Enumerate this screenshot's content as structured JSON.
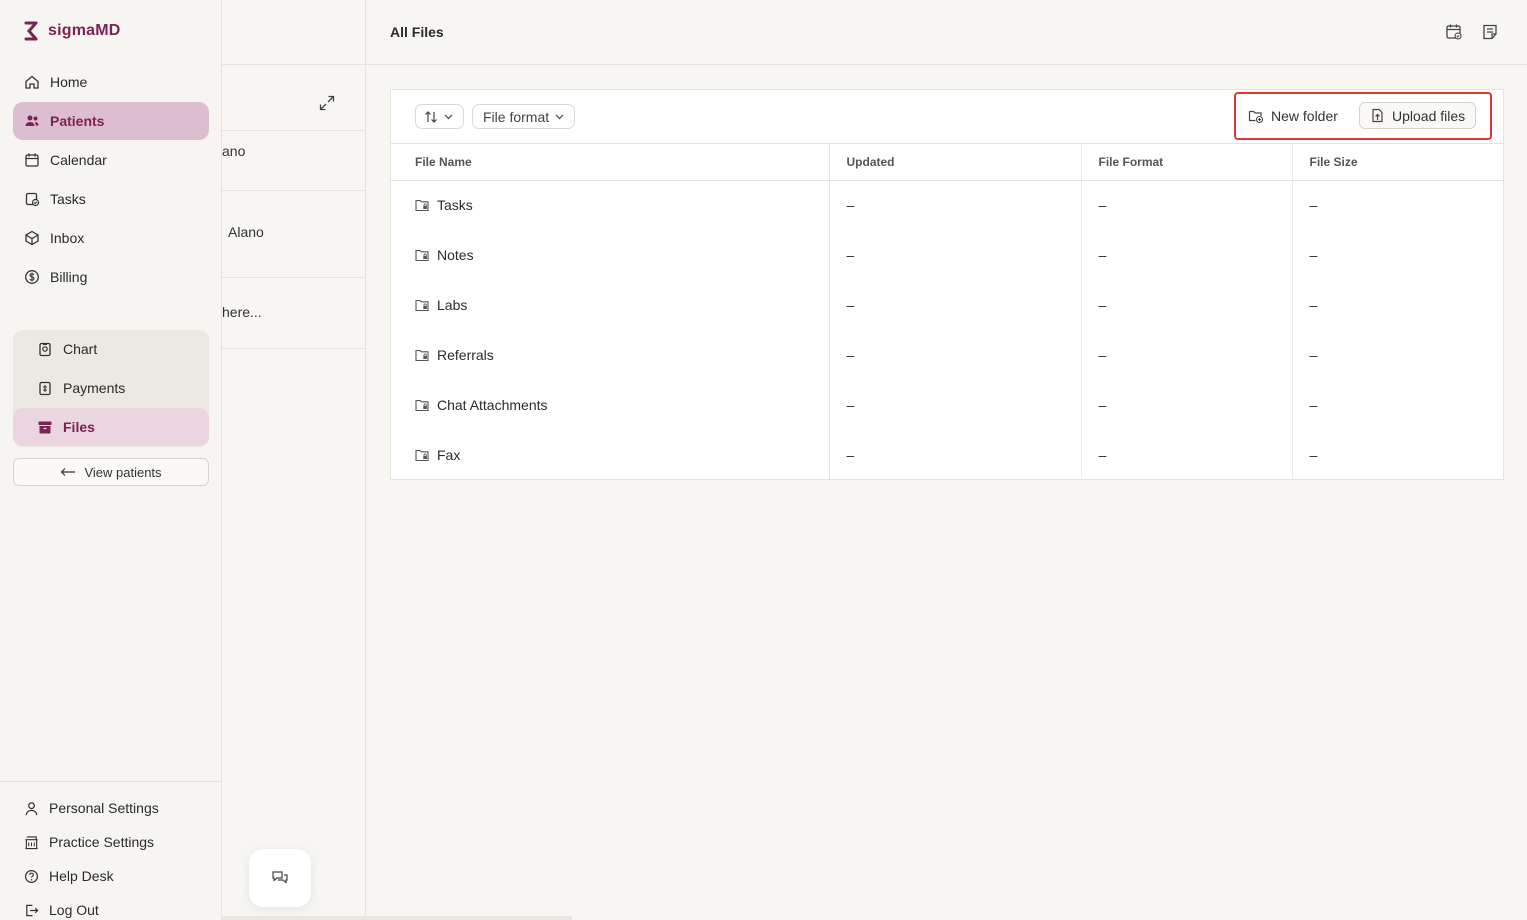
{
  "brand": {
    "name": "sigmaMD",
    "color": "#7c2356"
  },
  "sidebar": {
    "nav": [
      {
        "label": "Home",
        "icon": "home-icon",
        "active": false
      },
      {
        "label": "Patients",
        "icon": "users-icon",
        "active": true
      },
      {
        "label": "Calendar",
        "icon": "calendar-icon",
        "active": false
      },
      {
        "label": "Tasks",
        "icon": "tasks-icon",
        "active": false
      },
      {
        "label": "Inbox",
        "icon": "inbox-icon",
        "active": false
      },
      {
        "label": "Billing",
        "icon": "dollar-icon",
        "active": false
      }
    ],
    "subnav": [
      {
        "label": "Chart",
        "icon": "chart-icon",
        "active": false
      },
      {
        "label": "Payments",
        "icon": "payments-icon",
        "active": false
      },
      {
        "label": "Files",
        "icon": "archive-icon",
        "active": true
      }
    ],
    "view_patients": "View patients",
    "bottom": [
      {
        "label": "Personal Settings",
        "icon": "user-icon"
      },
      {
        "label": "Practice Settings",
        "icon": "building-icon"
      },
      {
        "label": "Help Desk",
        "icon": "help-icon"
      },
      {
        "label": "Log Out",
        "icon": "logout-icon"
      }
    ]
  },
  "middle": {
    "rows": [
      {
        "text": "ano"
      },
      {
        "text": "Alano"
      },
      {
        "text": "here..."
      }
    ]
  },
  "main": {
    "title": "All Files",
    "toolbar": {
      "format_filter": "File format",
      "new_folder": "New folder",
      "upload_files": "Upload files"
    },
    "table": {
      "columns": [
        "File Name",
        "Updated",
        "File Format",
        "File Size"
      ],
      "rows": [
        {
          "name": "Tasks",
          "updated": "–",
          "format": "–",
          "size": "–"
        },
        {
          "name": "Notes",
          "updated": "–",
          "format": "–",
          "size": "–"
        },
        {
          "name": "Labs",
          "updated": "–",
          "format": "–",
          "size": "–"
        },
        {
          "name": "Referrals",
          "updated": "–",
          "format": "–",
          "size": "–"
        },
        {
          "name": "Chat Attachments",
          "updated": "–",
          "format": "–",
          "size": "–"
        },
        {
          "name": "Fax",
          "updated": "–",
          "format": "–",
          "size": "–"
        }
      ]
    }
  },
  "colors": {
    "accent": "#7c2356",
    "active_bg": "#ddbdd0",
    "highlight": "#d93a32"
  }
}
